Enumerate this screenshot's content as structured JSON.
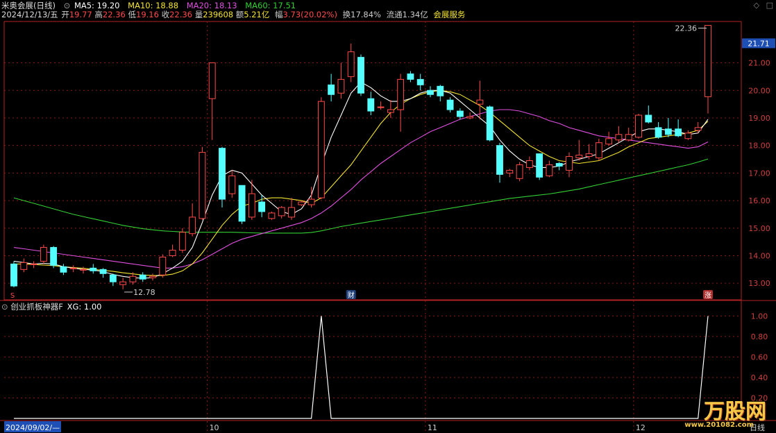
{
  "header": {
    "stock_title": "米奥会展(日线)",
    "ma5_label": "MA5: 19.20",
    "ma10_label": "MA10: 18.88",
    "ma20_label": "MA20: 18.13",
    "ma60_label": "MA60: 17.51",
    "date": "2024/12/13/五",
    "open_label": "开",
    "open": "19.77",
    "high_label": "高",
    "high": "22.36",
    "low_label": "低",
    "low": "19.16",
    "close_label": "收",
    "close": "22.36",
    "volume_label": "量",
    "volume": "239608",
    "amount_label": "额",
    "amount": "5.21亿",
    "change_label": "幅",
    "change": "3.73(20.02%)",
    "turnover": "换17.84%",
    "float_cap": "流通1.34亿",
    "sector": "会展服务",
    "icons": [
      "settings-diamond-icon",
      "window-toggle-icon"
    ]
  },
  "indicator": {
    "name": "创业抓板神器F",
    "value_label": "XG: 1.00"
  },
  "footer": {
    "start_date": "2024/09/02/—",
    "period": "日线",
    "months": [
      "10",
      "11",
      "12"
    ]
  },
  "markers": {
    "s": "S",
    "cai": "财",
    "zhang": "涨",
    "low_annot": "12.78",
    "high_annot": "22.36",
    "current_price": "21.71"
  },
  "watermark": {
    "brand": "万股网",
    "url": "www.201082.com"
  },
  "colors": {
    "up": "#ff4a4a",
    "down": "#54ffff",
    "ma5": "#ffffff",
    "ma10": "#f5e52f",
    "ma20": "#e050e0",
    "ma60": "#33d033",
    "grid": "#8b1a1a",
    "axis": "#b22222"
  },
  "chart_data": [
    {
      "type": "candlestick",
      "yticks": [
        13.0,
        14.0,
        15.0,
        16.0,
        17.0,
        18.0,
        19.0,
        20.0,
        21.0
      ],
      "ylim": [
        12.4,
        22.5
      ],
      "candles": [
        [
          13.7,
          12.9,
          13.8,
          12.85
        ],
        [
          13.5,
          13.75,
          13.9,
          13.4
        ],
        [
          13.7,
          13.7,
          13.8,
          13.55
        ],
        [
          13.8,
          14.3,
          14.4,
          13.7
        ],
        [
          14.3,
          13.65,
          14.35,
          13.55
        ],
        [
          13.6,
          13.4,
          13.7,
          13.3
        ],
        [
          13.55,
          13.55,
          13.65,
          13.4
        ],
        [
          13.5,
          13.5,
          13.6,
          13.35
        ],
        [
          13.55,
          13.45,
          13.7,
          13.35
        ],
        [
          13.5,
          13.35,
          13.55,
          13.2
        ],
        [
          13.3,
          13.05,
          13.35,
          12.9
        ],
        [
          12.95,
          13.05,
          13.2,
          12.78
        ],
        [
          13.05,
          13.25,
          13.4,
          12.95
        ],
        [
          13.3,
          13.15,
          13.4,
          13.05
        ],
        [
          13.2,
          13.25,
          13.35,
          13.1
        ],
        [
          13.3,
          13.95,
          14.05,
          13.2
        ],
        [
          14.0,
          14.2,
          14.4,
          13.95
        ],
        [
          14.2,
          14.85,
          15.0,
          14.1
        ],
        [
          14.8,
          15.4,
          15.9,
          14.7
        ],
        [
          15.35,
          17.75,
          17.95,
          15.3
        ],
        [
          19.7,
          21.0,
          21.0,
          18.2
        ],
        [
          17.9,
          16.05,
          17.95,
          15.75
        ],
        [
          16.25,
          16.9,
          17.1,
          16.1
        ],
        [
          16.55,
          15.25,
          16.55,
          15.15
        ],
        [
          15.4,
          16.25,
          16.75,
          15.3
        ],
        [
          15.95,
          15.6,
          16.2,
          15.4
        ],
        [
          15.35,
          15.55,
          15.6,
          15.3
        ],
        [
          15.45,
          15.75,
          15.8,
          15.35
        ],
        [
          15.4,
          15.75,
          16.1,
          15.3
        ],
        [
          15.85,
          15.95,
          16.0,
          15.8
        ],
        [
          15.85,
          16.05,
          16.5,
          15.75
        ],
        [
          16.1,
          19.6,
          19.75,
          16.05
        ],
        [
          20.2,
          19.85,
          20.6,
          19.6
        ],
        [
          19.9,
          20.4,
          21.0,
          19.7
        ],
        [
          20.5,
          21.4,
          21.7,
          20.3
        ],
        [
          21.2,
          19.9,
          21.3,
          19.8
        ],
        [
          19.7,
          19.25,
          19.95,
          19.1
        ],
        [
          19.4,
          19.4,
          19.6,
          19.3
        ],
        [
          19.2,
          19.3,
          19.65,
          19.0
        ],
        [
          19.3,
          20.4,
          20.6,
          18.5
        ],
        [
          20.6,
          20.4,
          20.7,
          20.3
        ],
        [
          20.4,
          20.2,
          20.6,
          20.0
        ],
        [
          20.0,
          19.85,
          20.15,
          19.75
        ],
        [
          20.15,
          19.8,
          20.2,
          19.6
        ],
        [
          19.65,
          19.3,
          19.75,
          19.2
        ],
        [
          19.25,
          19.05,
          19.35,
          18.95
        ],
        [
          19.0,
          19.05,
          19.2,
          18.95
        ],
        [
          19.5,
          19.65,
          20.35,
          18.95
        ],
        [
          19.4,
          18.2,
          19.45,
          18.15
        ],
        [
          18.0,
          16.95,
          18.1,
          16.65
        ],
        [
          17.0,
          17.1,
          17.15,
          16.85
        ],
        [
          16.8,
          17.3,
          17.4,
          16.7
        ],
        [
          17.2,
          17.45,
          17.6,
          17.1
        ],
        [
          17.7,
          16.85,
          17.7,
          16.75
        ],
        [
          16.9,
          17.3,
          17.45,
          16.85
        ],
        [
          17.35,
          17.25,
          17.4,
          17.1
        ],
        [
          17.1,
          17.6,
          17.75,
          16.85
        ],
        [
          17.55,
          17.65,
          18.2,
          17.45
        ],
        [
          17.6,
          17.7,
          18.05,
          17.5
        ],
        [
          17.55,
          18.1,
          18.25,
          17.45
        ],
        [
          18.05,
          18.25,
          18.5,
          18.0
        ],
        [
          18.2,
          18.4,
          18.7,
          18.1
        ],
        [
          18.2,
          18.4,
          18.65,
          18.15
        ],
        [
          18.3,
          19.1,
          19.15,
          18.25
        ],
        [
          19.1,
          18.85,
          19.45,
          18.8
        ],
        [
          18.65,
          18.3,
          18.85,
          18.25
        ],
        [
          18.6,
          18.4,
          19.0,
          18.3
        ],
        [
          18.6,
          18.35,
          18.95,
          18.3
        ],
        [
          18.25,
          18.45,
          18.55,
          18.2
        ],
        [
          18.55,
          18.65,
          18.85,
          18.45
        ],
        [
          19.77,
          22.36,
          22.36,
          19.16
        ]
      ],
      "ma5": [
        13.8,
        13.75,
        13.7,
        13.72,
        13.7,
        13.6,
        13.55,
        13.5,
        13.48,
        13.42,
        13.32,
        13.25,
        13.2,
        13.18,
        13.2,
        13.35,
        13.55,
        13.8,
        14.3,
        15.2,
        16.2,
        16.9,
        17.1,
        17.0,
        16.6,
        16.2,
        15.9,
        15.6,
        15.5,
        15.7,
        16.2,
        17.3,
        18.3,
        19.1,
        19.9,
        20.3,
        20.1,
        19.8,
        19.6,
        19.6,
        19.7,
        19.9,
        20.0,
        20.0,
        19.9,
        19.6,
        19.3,
        19.0,
        18.7,
        18.2,
        17.8,
        17.5,
        17.3,
        17.2,
        17.2,
        17.25,
        17.4,
        17.5,
        17.6,
        17.7,
        17.9,
        18.1,
        18.3,
        18.5,
        18.6,
        18.6,
        18.55,
        18.5,
        18.4,
        18.45,
        18.95
      ],
      "ma10": [
        13.7,
        13.7,
        13.68,
        13.66,
        13.64,
        13.6,
        13.57,
        13.54,
        13.5,
        13.47,
        13.43,
        13.38,
        13.34,
        13.3,
        13.28,
        13.28,
        13.33,
        13.45,
        13.7,
        14.1,
        14.6,
        15.1,
        15.5,
        15.8,
        15.9,
        16.05,
        16.1,
        16.1,
        16.05,
        16.0,
        15.9,
        16.1,
        16.5,
        16.9,
        17.3,
        17.8,
        18.3,
        18.8,
        19.2,
        19.5,
        19.7,
        19.85,
        19.95,
        20.0,
        19.95,
        19.85,
        19.65,
        19.45,
        19.2,
        18.9,
        18.6,
        18.3,
        18.0,
        17.8,
        17.6,
        17.45,
        17.4,
        17.35,
        17.4,
        17.45,
        17.6,
        17.75,
        17.95,
        18.1,
        18.25,
        18.3,
        18.35,
        18.4,
        18.45,
        18.55,
        18.88
      ],
      "ma20": [
        14.3,
        14.25,
        14.2,
        14.15,
        14.1,
        14.05,
        14.0,
        13.95,
        13.9,
        13.85,
        13.8,
        13.75,
        13.7,
        13.65,
        13.6,
        13.55,
        13.55,
        13.6,
        13.7,
        13.85,
        14.05,
        14.25,
        14.45,
        14.6,
        14.7,
        14.8,
        14.9,
        15.0,
        15.1,
        15.2,
        15.35,
        15.55,
        15.8,
        16.1,
        16.4,
        16.75,
        17.05,
        17.35,
        17.6,
        17.85,
        18.1,
        18.3,
        18.5,
        18.65,
        18.8,
        18.95,
        19.05,
        19.15,
        19.25,
        19.3,
        19.3,
        19.25,
        19.15,
        19.05,
        18.9,
        18.8,
        18.65,
        18.55,
        18.45,
        18.35,
        18.3,
        18.25,
        18.2,
        18.15,
        18.1,
        18.05,
        18.0,
        17.95,
        17.9,
        17.95,
        18.13
      ],
      "ma60": [
        16.1,
        16.0,
        15.9,
        15.8,
        15.7,
        15.6,
        15.5,
        15.42,
        15.34,
        15.26,
        15.18,
        15.1,
        15.04,
        14.98,
        14.94,
        14.9,
        14.88,
        14.86,
        14.85,
        14.85,
        14.85,
        14.85,
        14.85,
        14.84,
        14.83,
        14.82,
        14.82,
        14.82,
        14.82,
        14.82,
        14.84,
        14.9,
        14.98,
        15.06,
        15.12,
        15.18,
        15.24,
        15.3,
        15.36,
        15.42,
        15.48,
        15.54,
        15.6,
        15.66,
        15.72,
        15.78,
        15.84,
        15.9,
        15.96,
        16.02,
        16.08,
        16.12,
        16.16,
        16.2,
        16.24,
        16.3,
        16.36,
        16.42,
        16.5,
        16.58,
        16.66,
        16.74,
        16.82,
        16.9,
        16.98,
        17.06,
        17.14,
        17.22,
        17.3,
        17.4,
        17.51
      ]
    },
    {
      "type": "line",
      "name": "XG",
      "yticks": [
        0.2,
        0.4,
        0.6,
        0.8,
        1.0
      ],
      "ylim": [
        -0.02,
        1.05
      ],
      "values": [
        0,
        0,
        0,
        0,
        0,
        0,
        0,
        0,
        0,
        0,
        0,
        0,
        0,
        0,
        0,
        0,
        0,
        0,
        0,
        0,
        0,
        0,
        0,
        0,
        0,
        0,
        0,
        0,
        0,
        0,
        0,
        1,
        0,
        0,
        0,
        0,
        0,
        0,
        0,
        0,
        0,
        0,
        0,
        0,
        0,
        0,
        0,
        0,
        0,
        0,
        0,
        0,
        0,
        0,
        0,
        0,
        0,
        0,
        0,
        0,
        0,
        0,
        0,
        0,
        0,
        0,
        0,
        0,
        0,
        0,
        1
      ]
    }
  ]
}
